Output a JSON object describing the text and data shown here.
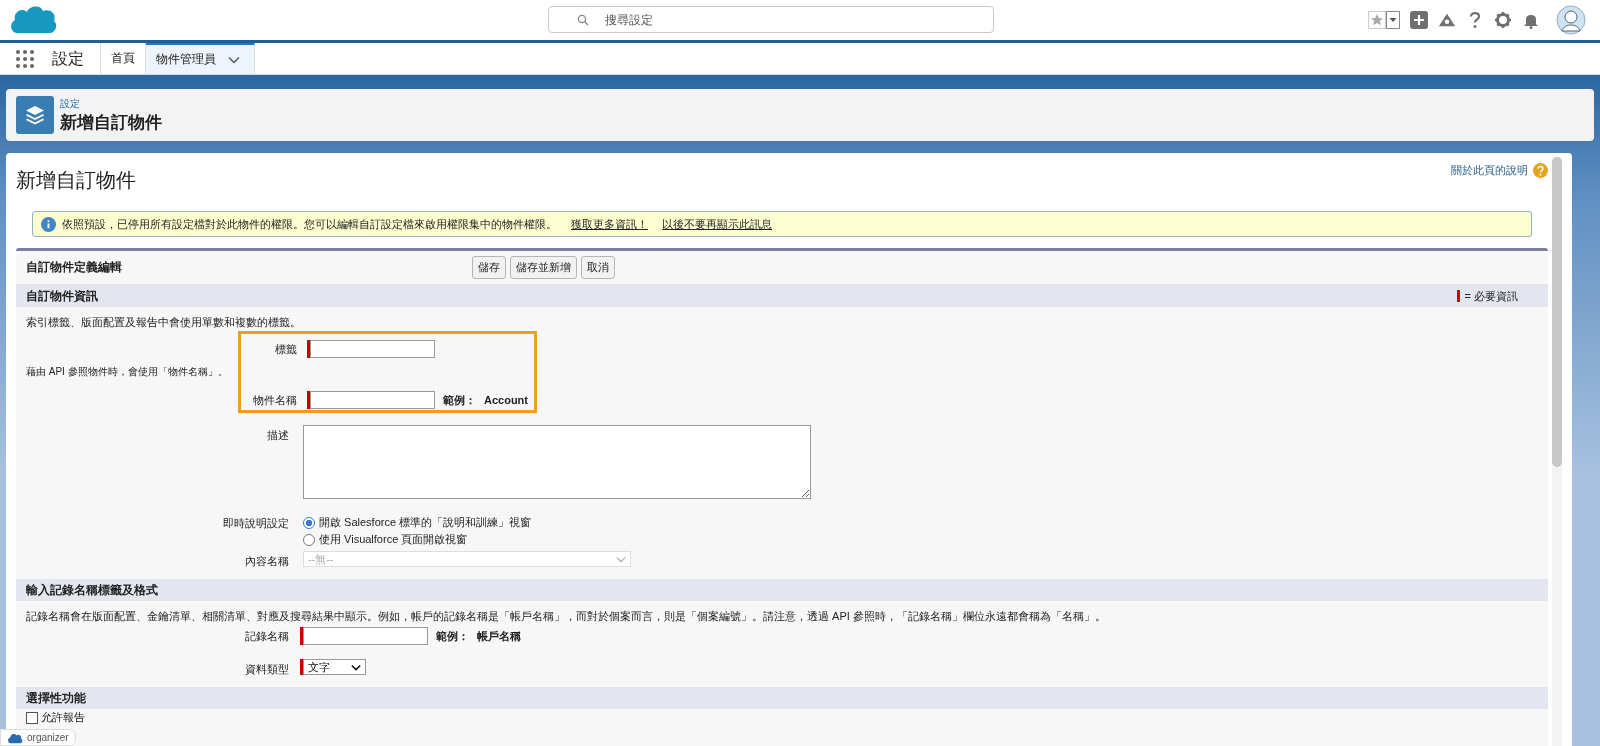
{
  "top_bar": {
    "search": {
      "placeholder": "搜尋設定"
    }
  },
  "nav": {
    "app_name": "設定",
    "tabs": [
      {
        "label": "首頁",
        "selected": false
      },
      {
        "label": "物件管理員",
        "selected": true
      }
    ]
  },
  "page_header": {
    "breadcrumb": "設定",
    "title": "新增自訂物件"
  },
  "content": {
    "title": "新增自訂物件",
    "help_link": "關於此頁的說明",
    "notice": {
      "text": "依照預設，已停用所有設定檔對於此物件的權限。您可以編輯自訂設定檔來啟用權限集中的物件權限。",
      "links": [
        "獲取更多資訊！",
        "以後不要再顯示此訊息"
      ]
    },
    "block_title": "自訂物件定義編輯",
    "buttons": [
      "儲存",
      "儲存並新增",
      "取消"
    ],
    "sections": [
      {
        "title": "自訂物件資訊",
        "required_legend": "= 必要資訊",
        "rows": [
          {
            "kind": "note",
            "text": "索引標籤、版面配置及報告中會使用單數和複數的標籤。"
          },
          {
            "kind": "highlight_group",
            "side_note": "藉由 API 參照物件時，會使用「物件名稱」。",
            "rows": [
              {
                "kind": "text",
                "label": "標籤",
                "required": true
              },
              {
                "kind": "text",
                "label": "物件名稱",
                "required": true,
                "example_label": "範例：",
                "example": "Account"
              }
            ]
          },
          {
            "kind": "textarea",
            "label": "描述",
            "required": false
          },
          {
            "kind": "radios",
            "label": "即時說明設定",
            "options": [
              {
                "label": "開啟 Salesforce 標準的「說明和訓練」視窗",
                "selected": true
              },
              {
                "label": "使用 Visualforce 頁面開啟視窗",
                "selected": false
              }
            ]
          },
          {
            "kind": "select",
            "label": "內容名稱",
            "value": "--無--",
            "required": false,
            "disabled": true
          }
        ]
      },
      {
        "title": "輸入記錄名稱標籤及格式",
        "rows": [
          {
            "kind": "note",
            "text": "記錄名稱會在版面配置、金鑰清單、相關清單、對應及搜尋結果中顯示。例如，帳戶的記錄名稱是「帳戶名稱」，而對於個案而言，則是「個案編號」。請注意，透過 API 參照時，「記錄名稱」欄位永遠都會稱為「名稱」。"
          },
          {
            "kind": "text",
            "label": "記錄名稱",
            "required": true,
            "example_label": "範例：",
            "example": "帳戶名稱"
          },
          {
            "kind": "select",
            "label": "資料類型",
            "value": "文字",
            "required": true,
            "disabled": false
          }
        ]
      },
      {
        "title": "選擇性功能",
        "rows": [
          {
            "kind": "checkbox",
            "label": "允許報告",
            "checked": false
          }
        ]
      }
    ]
  },
  "overlay_badge": {
    "label": "organizer"
  }
}
